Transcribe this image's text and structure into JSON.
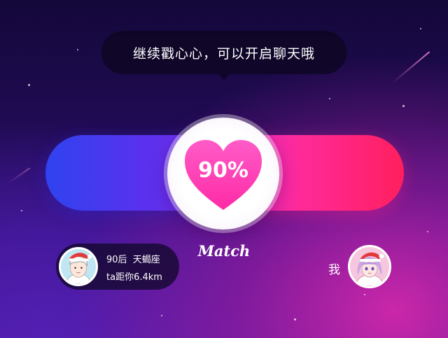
{
  "tooltip": {
    "text": "继续戳心心，可以开启聊天哦"
  },
  "match": {
    "percent_label": "90%",
    "percent_value": 90,
    "label": "Match"
  },
  "other_user": {
    "age_group": "90后",
    "zodiac": "天蝎座",
    "distance": "ta距你6.4km"
  },
  "self_user": {
    "label": "我"
  },
  "colors": {
    "bar_left_start": "#2f43ef",
    "bar_left_end": "#8a2ff0",
    "bar_right_start": "#e02bd5",
    "bar_right_end": "#ff1f5e",
    "heart": "#ff3fb4"
  }
}
